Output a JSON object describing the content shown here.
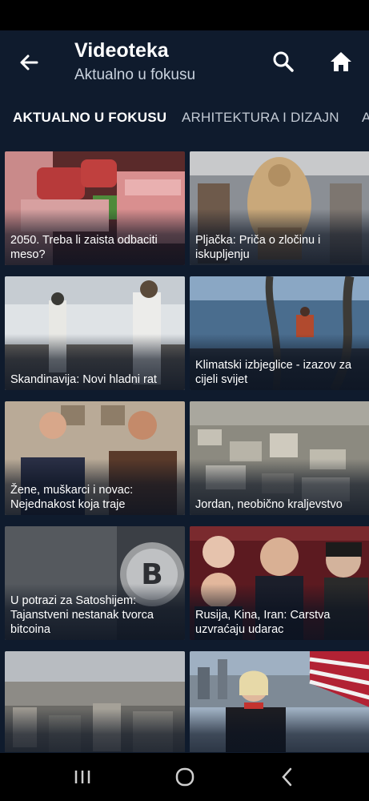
{
  "header": {
    "title": "Videoteka",
    "subtitle": "Aktualno u fokusu"
  },
  "icons": {
    "back": "arrow-left-icon",
    "search": "search-icon",
    "home": "home-icon"
  },
  "tabs": [
    {
      "label": "AKTUALNO U FOKUSU",
      "active": true
    },
    {
      "label": "ARHITEKTURA I DIZAJN",
      "active": false
    },
    {
      "label": "A",
      "active": false
    }
  ],
  "videos": [
    {
      "caption": "2050. Treba li zaista odbaciti meso?"
    },
    {
      "caption": "Pljačka: Priča o zločinu i iskupljenju"
    },
    {
      "caption": "Skandinavija: Novi hladni rat"
    },
    {
      "caption": "Klimatski izbjeglice - izazov za cijeli svijet"
    },
    {
      "caption": "Žene, muškarci i novac: Nejednakost koja traje"
    },
    {
      "caption": "Jordan, neobično kraljevstvo"
    },
    {
      "caption": "U potrazi za Satoshijem: Tajanstveni nestanak tvorca bitcoina"
    },
    {
      "caption": "Rusija, Kina, Iran: Carstva uzvraćaju udarac"
    },
    {
      "caption": ""
    },
    {
      "caption": ""
    }
  ],
  "system_nav": [
    "recent-apps-icon",
    "home-circle-icon",
    "back-chevron-icon"
  ],
  "colors": {
    "background": "#0f1b2d",
    "status_bar": "#000000",
    "text_primary": "#ffffff",
    "text_secondary": "#c9d2de"
  }
}
